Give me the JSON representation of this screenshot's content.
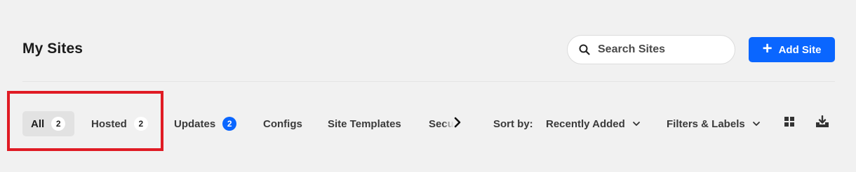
{
  "header": {
    "title": "My Sites",
    "search_placeholder": "Search Sites",
    "add_site_label": "Add Site"
  },
  "tabs": [
    {
      "label": "All",
      "count": "2",
      "active": true
    },
    {
      "label": "Hosted",
      "count": "2",
      "active": false
    },
    {
      "label": "Updates",
      "count": "2",
      "active": false
    },
    {
      "label": "Configs",
      "active": false
    },
    {
      "label": "Site Templates",
      "active": false
    },
    {
      "label": "Secu",
      "active": false
    }
  ],
  "toolbar": {
    "sort_label": "Sort by:",
    "sort_value": "Recently Added",
    "filters_label": "Filters & Labels"
  },
  "icons": {
    "search": "search-icon",
    "add": "plus-icon",
    "scroll_next": "chevron-right-icon",
    "dropdown": "chevron-down-icon",
    "grid_view": "grid-view-icon",
    "export": "download-icon"
  },
  "colors": {
    "accent": "#0a66ff",
    "background": "#f1f1f1",
    "highlight": "#e01b24"
  }
}
